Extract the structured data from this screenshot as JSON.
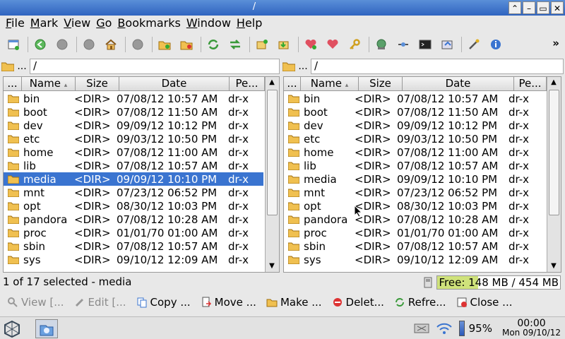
{
  "window": {
    "title": "/"
  },
  "menu": [
    "File",
    "Mark",
    "View",
    "Go",
    "Bookmarks",
    "Window",
    "Help"
  ],
  "toolbar": {
    "more_label": "»"
  },
  "left": {
    "path_prefix": "...",
    "path": "/",
    "headers": {
      "first": "...",
      "name": "Name",
      "sort": "▴",
      "size": "Size",
      "date": "Date",
      "perm": "Pe..."
    },
    "rows": [
      {
        "name": "bin",
        "size": "<DIR>",
        "date": "07/08/12 10:57 AM",
        "perm": "dr-x"
      },
      {
        "name": "boot",
        "size": "<DIR>",
        "date": "07/08/12 11:50 AM",
        "perm": "dr-x"
      },
      {
        "name": "dev",
        "size": "<DIR>",
        "date": "09/09/12 10:12 PM",
        "perm": "dr-x"
      },
      {
        "name": "etc",
        "size": "<DIR>",
        "date": "09/03/12 10:50 PM",
        "perm": "dr-x"
      },
      {
        "name": "home",
        "size": "<DIR>",
        "date": "07/08/12 11:00 AM",
        "perm": "dr-x"
      },
      {
        "name": "lib",
        "size": "<DIR>",
        "date": "07/08/12 10:57 AM",
        "perm": "dr-x"
      },
      {
        "name": "media",
        "size": "<DIR>",
        "date": "09/09/12 10:10 PM",
        "perm": "dr-x",
        "selected": true
      },
      {
        "name": "mnt",
        "size": "<DIR>",
        "date": "07/23/12 06:52 PM",
        "perm": "dr-x"
      },
      {
        "name": "opt",
        "size": "<DIR>",
        "date": "08/30/12 10:03 PM",
        "perm": "dr-x"
      },
      {
        "name": "pandora",
        "size": "<DIR>",
        "date": "07/08/12 10:28 AM",
        "perm": "dr-x"
      },
      {
        "name": "proc",
        "size": "<DIR>",
        "date": "01/01/70 01:00 AM",
        "perm": "dr-x"
      },
      {
        "name": "sbin",
        "size": "<DIR>",
        "date": "07/08/12 10:57 AM",
        "perm": "dr-x"
      },
      {
        "name": "sys",
        "size": "<DIR>",
        "date": "09/10/12 12:09 AM",
        "perm": "dr-x"
      }
    ]
  },
  "right": {
    "path_prefix": "...",
    "path": "/",
    "headers": {
      "first": "...",
      "name": "Name",
      "sort": "▴",
      "size": "Size",
      "date": "Date",
      "perm": "Pe..."
    },
    "rows": [
      {
        "name": "bin",
        "size": "<DIR>",
        "date": "07/08/12 10:57 AM",
        "perm": "dr-x"
      },
      {
        "name": "boot",
        "size": "<DIR>",
        "date": "07/08/12 11:50 AM",
        "perm": "dr-x"
      },
      {
        "name": "dev",
        "size": "<DIR>",
        "date": "09/09/12 10:12 PM",
        "perm": "dr-x"
      },
      {
        "name": "etc",
        "size": "<DIR>",
        "date": "09/03/12 10:50 PM",
        "perm": "dr-x"
      },
      {
        "name": "home",
        "size": "<DIR>",
        "date": "07/08/12 11:00 AM",
        "perm": "dr-x"
      },
      {
        "name": "lib",
        "size": "<DIR>",
        "date": "07/08/12 10:57 AM",
        "perm": "dr-x"
      },
      {
        "name": "media",
        "size": "<DIR>",
        "date": "09/09/12 10:10 PM",
        "perm": "dr-x"
      },
      {
        "name": "mnt",
        "size": "<DIR>",
        "date": "07/23/12 06:52 PM",
        "perm": "dr-x"
      },
      {
        "name": "opt",
        "size": "<DIR>",
        "date": "08/30/12 10:03 PM",
        "perm": "dr-x"
      },
      {
        "name": "pandora",
        "size": "<DIR>",
        "date": "07/08/12 10:28 AM",
        "perm": "dr-x"
      },
      {
        "name": "proc",
        "size": "<DIR>",
        "date": "01/01/70 01:00 AM",
        "perm": "dr-x"
      },
      {
        "name": "sbin",
        "size": "<DIR>",
        "date": "07/08/12 10:57 AM",
        "perm": "dr-x"
      },
      {
        "name": "sys",
        "size": "<DIR>",
        "date": "09/10/12 12:09 AM",
        "perm": "dr-x"
      }
    ]
  },
  "status": {
    "text": "1 of 17 selected - media",
    "free_text": "Free: 148 MB / 454 MB",
    "used_fraction": 0.33
  },
  "actions": {
    "view": "View [...",
    "edit": "Edit [...",
    "copy": "Copy ...",
    "move": "Move ...",
    "make": "Make ...",
    "delete": "Delet...",
    "refresh": "Refre...",
    "close": "Close ..."
  },
  "taskbar": {
    "battery": "95%",
    "time": "00:00",
    "date": "Mon 09/10/12"
  },
  "colors": {
    "selection": "#3a74d0",
    "titlebar": "#2f64c0",
    "free_fill": "#cfe27b"
  }
}
